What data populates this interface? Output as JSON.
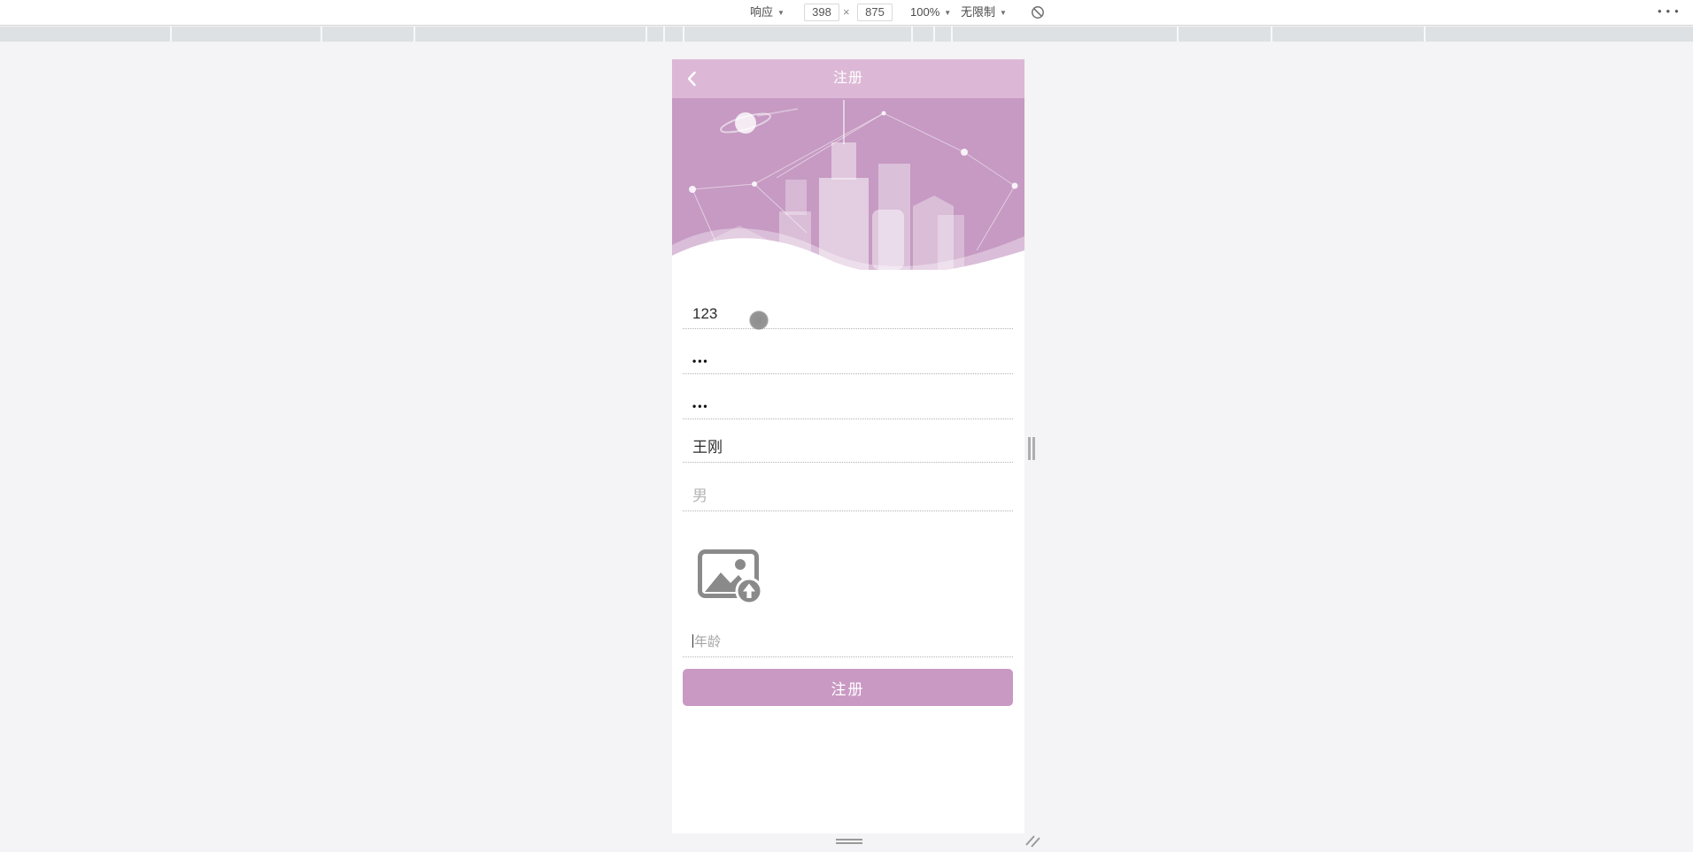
{
  "toolbar": {
    "device_mode_label": "响应",
    "caret": "▼",
    "width_value": "398",
    "dim_separator": "×",
    "height_value": "875",
    "zoom_label": "100%",
    "throttle_label": "无限制",
    "more_menu_icon": "•••",
    "rotate_icon": "rotate-disabled"
  },
  "app": {
    "header_title": "注册",
    "back_icon": "chevron-left",
    "fields": [
      {
        "name": "account",
        "value": "123",
        "state": "filled"
      },
      {
        "name": "password",
        "value": "•••",
        "state": "masked"
      },
      {
        "name": "confirm-password",
        "value": "•••",
        "state": "masked"
      },
      {
        "name": "realname",
        "value": "王刚",
        "state": "filled"
      },
      {
        "name": "gender",
        "value": "男",
        "state": "ghost"
      }
    ],
    "age_placeholder": "年龄",
    "register_button_label": "注册",
    "upload_icon": "image-upload"
  },
  "colors": {
    "header_pink": "#dcb8d6",
    "hero_pink": "#c69ac3",
    "button_pink": "#c999c4",
    "toolbar_bg": "#ffffff",
    "ruler_bg": "#dee1e4",
    "page_bg": "#f4f3f5"
  }
}
